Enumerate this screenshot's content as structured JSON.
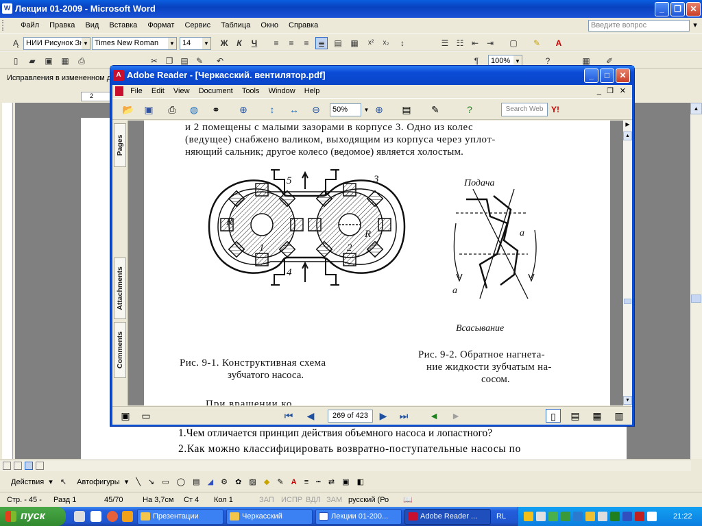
{
  "word": {
    "title": "Лекции 01-2009 - Microsoft Word",
    "app_icon": "W",
    "menu": [
      "Файл",
      "Правка",
      "Вид",
      "Вставка",
      "Формат",
      "Сервис",
      "Таблица",
      "Окно",
      "Справка"
    ],
    "help_placeholder": "Введите вопрос",
    "style_combo": "НИИ Рисунок Зн",
    "font_combo": "Times New Roman",
    "size_combo": "14",
    "bold": "Ж",
    "italic": "К",
    "underline": "Ч",
    "zoom": "100%",
    "revision_bar": "Исправления в измененном д",
    "ruler_mark": "2",
    "doc_lines": [
      "1.Чем отличается принцип действия объемного насоса и лопастного?",
      "2.Как можно классифицировать возвратно-поступательные насосы по"
    ],
    "draw_menu": "Действия",
    "autoshapes": "Автофигуры",
    "status": {
      "page": "Стр. - 45 -",
      "section": "Разд 1",
      "pages": "45/70",
      "at": "На 3,7см",
      "line": "Ст 4",
      "col": "Кол 1",
      "rec": "ЗАП",
      "trk": "ИСПР",
      "ext": "ВДЛ",
      "ovr": "ЗАМ",
      "lang": "русский (Ро"
    }
  },
  "reader": {
    "title": "Adobe Reader - [Черкасский. вентилятор.pdf]",
    "app_icon": "A",
    "menu": [
      "File",
      "Edit",
      "View",
      "Document",
      "Tools",
      "Window",
      "Help"
    ],
    "zoom": "50%",
    "search_placeholder": "Search Web",
    "yahoo": "Y!",
    "side_tabs": [
      "Pages",
      "Attachments",
      "Comments"
    ],
    "page_label": "269 of 423",
    "pdf": {
      "line1": "и 2 помещены с малыми зазорами в корпусе 3. Одно из колес",
      "line2": "(ведущее) снабжено валиком, выходящим из корпуса через уплот-",
      "line3": "няющий сальник; другое колесо (ведомое) является холостым.",
      "fig1_caption_1": "Рис. 9-1. Конструктивная схема",
      "fig1_caption_2": "зубчатого насоса.",
      "fig2_caption_1": "Рис. 9-2. Обратное нагнета-",
      "fig2_caption_2": "ние жидкости зубчатым на-",
      "fig2_caption_3": "сосом.",
      "fig2_top_label": "Подача",
      "fig2_bottom_label": "Всасывание",
      "label_a": "a",
      "label_5": "5",
      "label_4": "4",
      "label_3": "3",
      "label_1": "1",
      "label_2": "2",
      "label_R": "R",
      "partial_line": "При вращении ко"
    }
  },
  "taskbar": {
    "start": "пуск",
    "tasks": [
      {
        "label": "Презентации",
        "icon": "folder-icon"
      },
      {
        "label": "Черкасский",
        "icon": "folder-icon"
      },
      {
        "label": "Лекции 01-200...",
        "icon": "word-icon"
      },
      {
        "label": "Adobe Reader ...",
        "icon": "adobe-reader-icon"
      }
    ],
    "lang": "RL",
    "clock": "21:22"
  }
}
